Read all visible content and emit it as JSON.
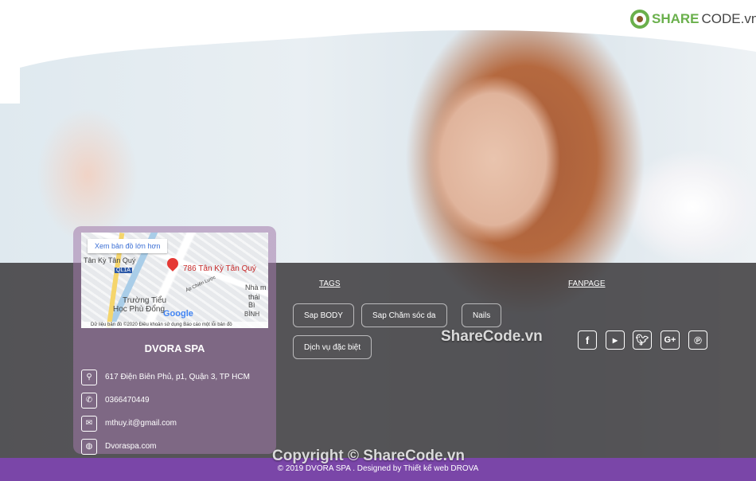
{
  "logo": {
    "text_green": "SHARE",
    "text_dark": "CODE.vn"
  },
  "map": {
    "larger_map": "Xem bản đồ lớn hơn",
    "place_label": "786 Tân Kỳ Tân Quý",
    "labels": [
      "Tân Kỳ Tân Quý",
      "QL1A",
      "Trường Tiểu",
      "Học Phù Đổng",
      "Nhà m",
      "thái Bì",
      "Áp Chiến Lược",
      "BÌNH"
    ],
    "google": "Google",
    "footer": "Dữ liệu bản đồ ©2020   Điều khoản sử dụng   Báo cáo một lỗi bản đồ"
  },
  "contact": {
    "name": "DVORA SPA",
    "items": [
      {
        "icon": "map-pin-icon",
        "text": "617 Điện Biên Phủ, p1, Quận 3, TP HCM"
      },
      {
        "icon": "phone-icon",
        "text": "0366470449"
      },
      {
        "icon": "mail-icon",
        "text": "mthuy.it@gmail.com"
      },
      {
        "icon": "globe-icon",
        "text": "Dvoraspa.com"
      }
    ]
  },
  "tags": {
    "title": "TAGS",
    "items": [
      "Sap BODY",
      "Sap Chăm sóc da",
      "Nails",
      "Dịch vụ đặc biệt"
    ]
  },
  "fanpage": {
    "title": "FANPAGE",
    "icons": [
      "facebook-icon",
      "youtube-icon",
      "twitter-icon",
      "google-plus-icon",
      "pinterest-icon"
    ]
  },
  "watermarks": {
    "center": "ShareCode.vn",
    "copyright": "Copyright © ShareCode.vn"
  },
  "footer": {
    "text": "© 2019 DVORA SPA . Designed by Thiết kế web DROVA"
  },
  "colors": {
    "footer": "#7a46a8",
    "logo_green": "#6ab04c"
  }
}
